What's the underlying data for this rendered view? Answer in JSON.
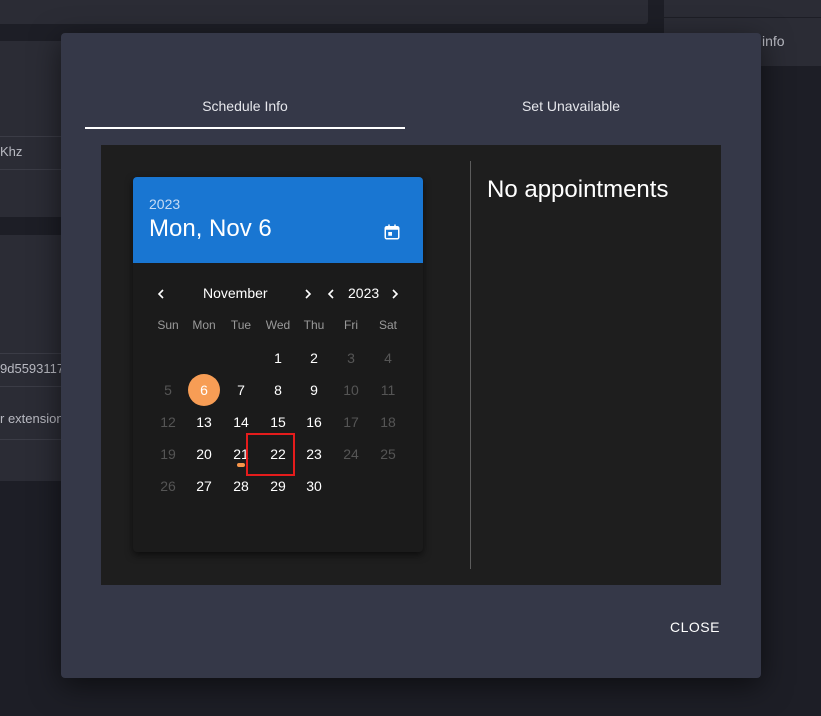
{
  "background": {
    "right_label": "info",
    "text_1": "Khz",
    "text_2": "9d5593117",
    "text_3": "r extension"
  },
  "dialog": {
    "tabs": [
      {
        "label": "Schedule Info",
        "active": true
      },
      {
        "label": "Set Unavailable",
        "active": false
      }
    ],
    "close_label": "CLOSE"
  },
  "picker": {
    "header_year": "2023",
    "header_date": "Mon, Nov 6",
    "month": "November",
    "year": "2023",
    "weekdays": [
      "Sun",
      "Mon",
      "Tue",
      "Wed",
      "Thu",
      "Fri",
      "Sat"
    ],
    "weeks": [
      [
        null,
        null,
        null,
        "1",
        "2",
        "3",
        "4"
      ],
      [
        "5",
        "6",
        "7",
        "8",
        "9",
        "10",
        "11"
      ],
      [
        "12",
        "13",
        "14",
        "15",
        "16",
        "17",
        "18"
      ],
      [
        "19",
        "20",
        "21",
        "22",
        "23",
        "24",
        "25"
      ],
      [
        "26",
        "27",
        "28",
        "29",
        "30",
        null,
        null
      ]
    ],
    "disabled_days": [
      "3",
      "4",
      "5",
      "10",
      "11",
      "12",
      "17",
      "18",
      "19",
      "24",
      "25",
      "26"
    ],
    "selected_day": "6",
    "event_days": [
      "21"
    ],
    "highlighted_day": "21"
  },
  "appointments": {
    "empty_label": "No appointments"
  },
  "colors": {
    "header_blue": "#1976d2",
    "selected_orange": "#f79d55",
    "highlight_red": "#e51c1c"
  }
}
